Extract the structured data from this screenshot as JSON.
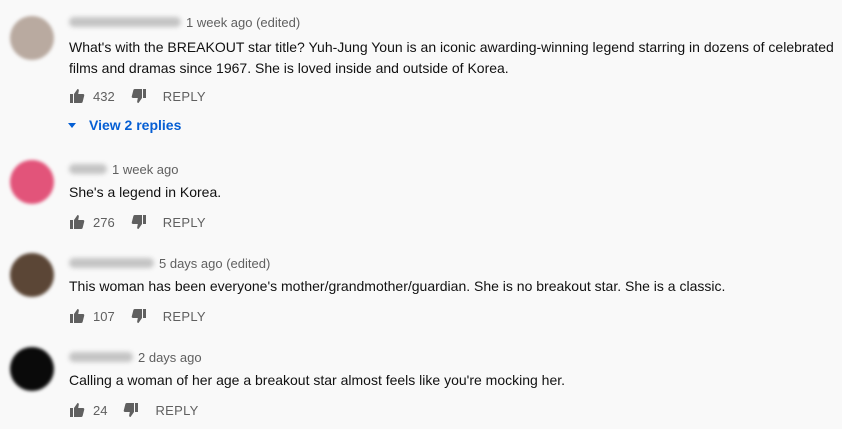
{
  "comments": [
    {
      "timestamp": "1 week ago (edited)",
      "text": "What's with the BREAKOUT star title? Yuh-Jung Youn is an iconic awarding-winning legend starring in dozens of celebrated films and dramas since 1967. She is loved inside and outside of Korea.",
      "likes": "432",
      "reply_label": "REPLY",
      "avatar_color": "#b9aaa0",
      "view_replies_label": "View 2 replies"
    },
    {
      "timestamp": "1 week ago",
      "text": "She's a legend in Korea.",
      "likes": "276",
      "reply_label": "REPLY",
      "avatar_color": "#e2547a"
    },
    {
      "timestamp": "5 days ago (edited)",
      "text": "This woman has been everyone's mother/grandmother/guardian. She is no breakout star. She is a classic.",
      "likes": "107",
      "reply_label": "REPLY",
      "avatar_color": "#5b4636"
    },
    {
      "timestamp": "2 days ago",
      "text": "Calling a woman of her age a breakout star almost feels like you're mocking her.",
      "likes": "24",
      "reply_label": "REPLY",
      "avatar_color": "#0a0a0a"
    }
  ],
  "icons": {
    "like": "thumbs-up-icon",
    "dislike": "thumbs-down-icon",
    "expand": "caret-down-icon"
  },
  "colors": {
    "link": "#065fd4",
    "meta": "#606060",
    "background": "#f9f9f9"
  }
}
